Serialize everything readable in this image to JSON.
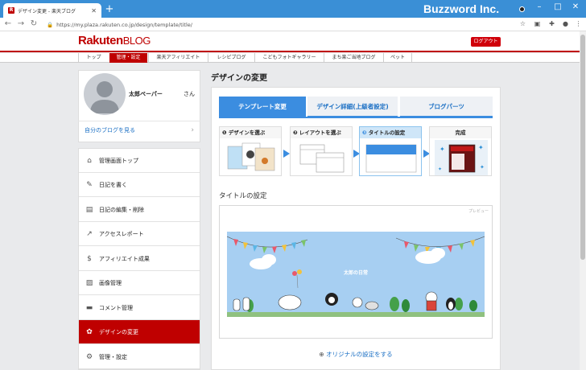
{
  "browser": {
    "tab_title": "デザイン変更 - 楽天ブログ",
    "favicon": "R",
    "brand": "Buzzword Inc.",
    "url": "https://my.plaza.rakuten.co.jp/design/template/title/"
  },
  "header": {
    "logo_main": "Rakuten",
    "logo_sub": "BLOG",
    "logout": "ログアウト"
  },
  "global_nav": [
    {
      "label": "トップ"
    },
    {
      "label": "管理・設定"
    },
    {
      "label": "楽天アフィリエイト"
    },
    {
      "label": "レシピブログ"
    },
    {
      "label": "こどもフォトギャラリー"
    },
    {
      "label": "まち楽ご当地ブログ"
    },
    {
      "label": "ペット"
    }
  ],
  "profile": {
    "name": "太郎ペーパー",
    "honorific": "さん",
    "my_blog": "自分のブログを見る"
  },
  "menu": [
    {
      "label": "管理画面トップ",
      "icon": "home-icon"
    },
    {
      "label": "日記を書く",
      "icon": "pencil-icon"
    },
    {
      "label": "日記の編集・削除",
      "icon": "document-icon"
    },
    {
      "label": "アクセスレポート",
      "icon": "chart-line-icon"
    },
    {
      "label": "アフィリエイト成果",
      "icon": "money-bag-icon"
    },
    {
      "label": "画像管理",
      "icon": "image-icon"
    },
    {
      "label": "コメント管理",
      "icon": "comment-icon"
    },
    {
      "label": "デザインの変更",
      "icon": "palette-icon"
    },
    {
      "label": "管理・設定",
      "icon": "gear-icon"
    }
  ],
  "main": {
    "title": "デザインの変更",
    "tabs": [
      {
        "label": "テンプレート変更"
      },
      {
        "label": "デザイン詳細(上級者設定)"
      },
      {
        "label": "ブログパーツ"
      }
    ],
    "steps": [
      {
        "num": "1",
        "label": "デザインを選ぶ"
      },
      {
        "num": "2",
        "label": "レイアウトを選ぶ"
      },
      {
        "num": "3",
        "label": "タイトルの設定"
      },
      {
        "num": "",
        "label": "完成"
      }
    ],
    "section_title": "タイトルの設定",
    "preview_label": "プレビュー",
    "banner_title": "太郎の日常",
    "original_link": "オリジナルの設定をする"
  },
  "colors": {
    "brand_red": "#bf0000",
    "accent_blue": "#3b8de0",
    "chrome_blue": "#3a8fd6"
  }
}
